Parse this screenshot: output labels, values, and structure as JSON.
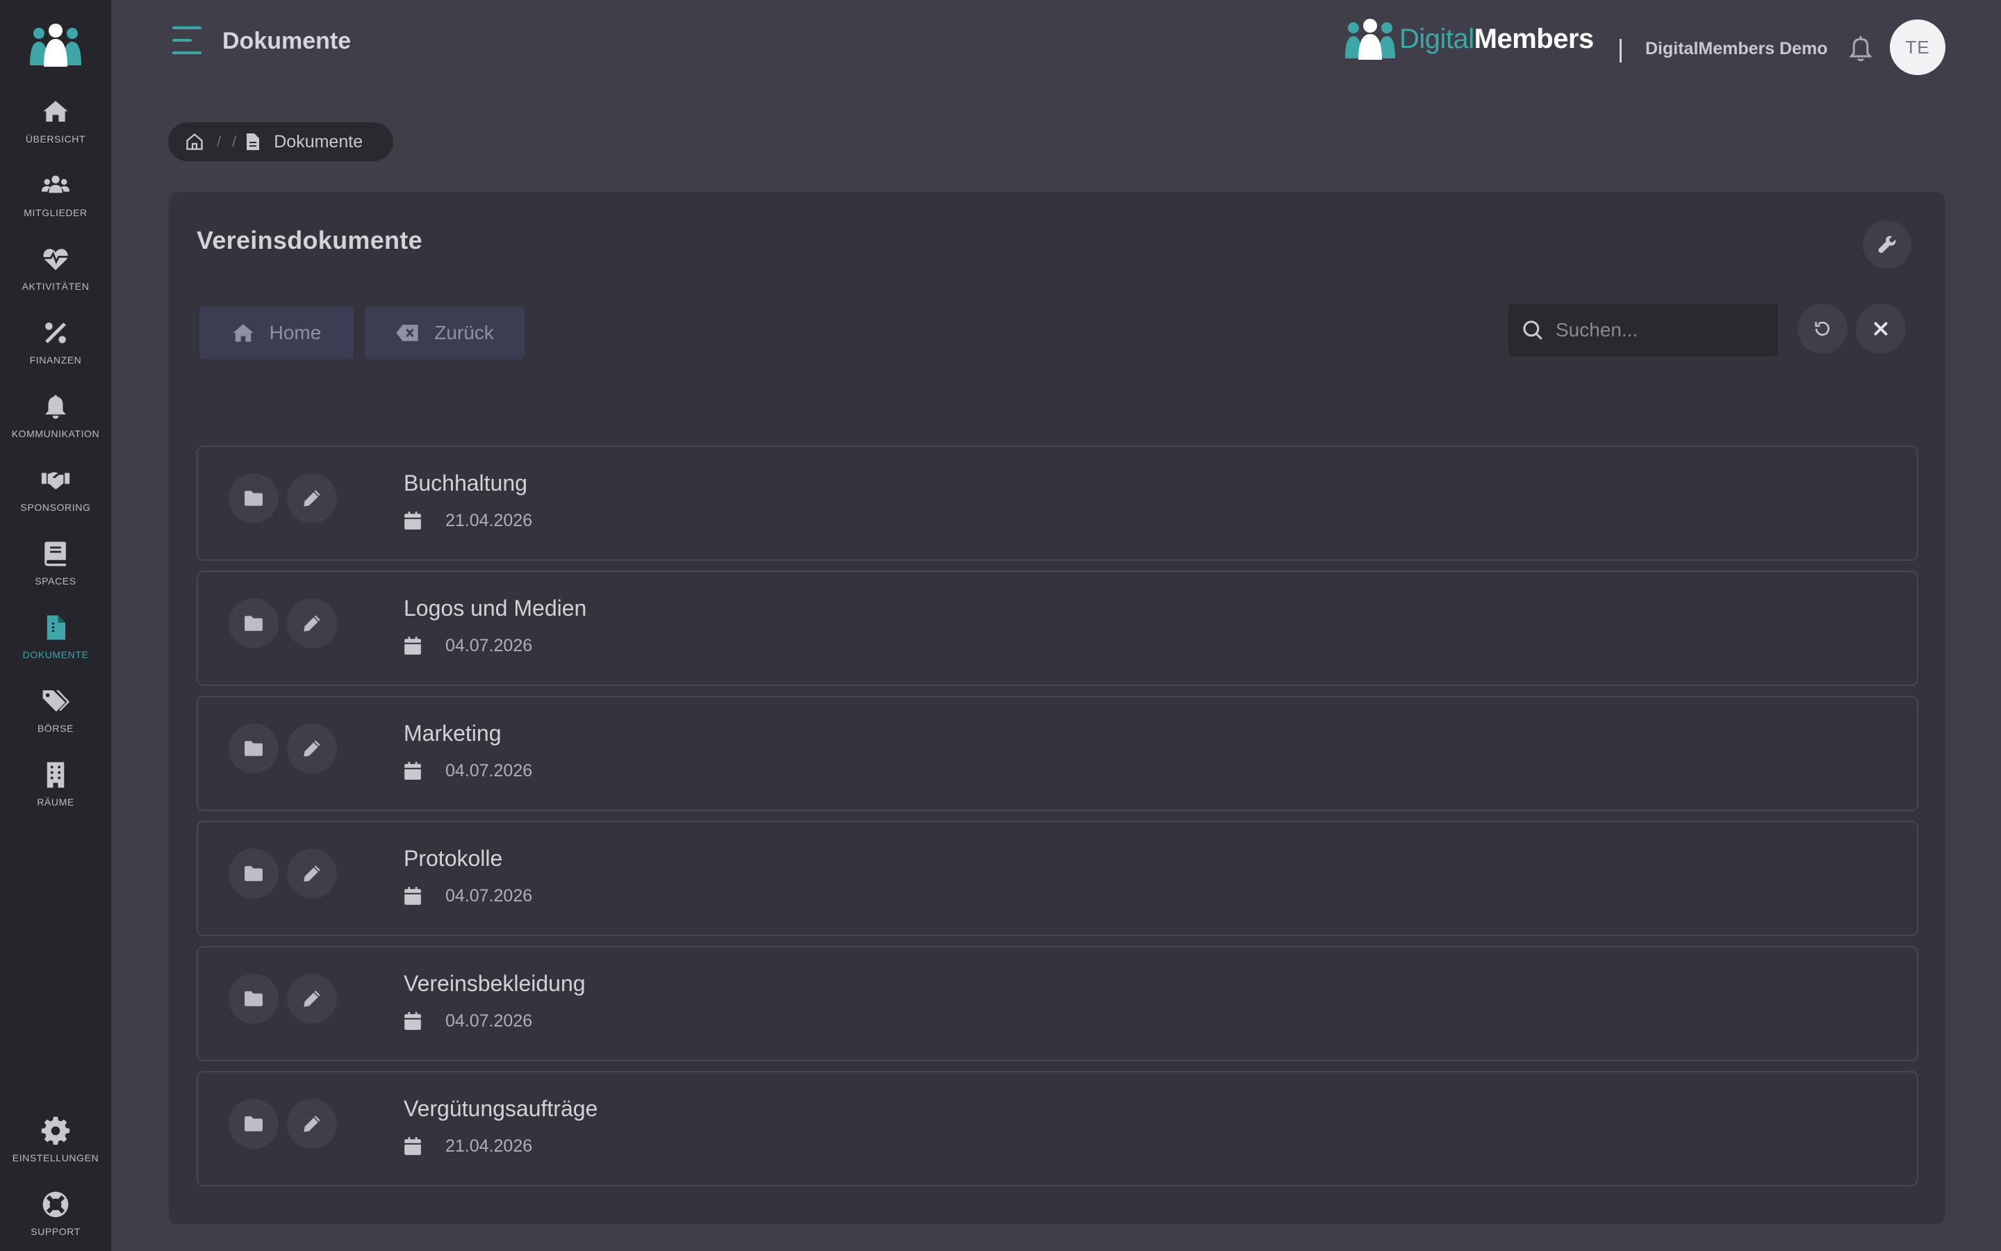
{
  "app": {
    "page_title": "Dokumente",
    "brand_part1": "Digital",
    "brand_part2": "Members",
    "org_name": "DigitalMembers Demo",
    "avatar_initials": "TE"
  },
  "colors": {
    "accent": "#3fa6a8",
    "sidebar_bg": "#26252b",
    "page_bg": "#403e48",
    "card_bg": "#35333c"
  },
  "sidebar": {
    "items": [
      {
        "label": "Übersicht",
        "icon": "home-icon"
      },
      {
        "label": "Mitglieder",
        "icon": "users-icon"
      },
      {
        "label": "Aktivitäten",
        "icon": "heartbeat-icon"
      },
      {
        "label": "Finanzen",
        "icon": "percent-icon"
      },
      {
        "label": "Kommunikation",
        "icon": "bell-icon"
      },
      {
        "label": "Sponsoring",
        "icon": "handshake-icon"
      },
      {
        "label": "Spaces",
        "icon": "book-icon"
      },
      {
        "label": "Dokumente",
        "icon": "document-icon",
        "active": true
      },
      {
        "label": "Börse",
        "icon": "tags-icon"
      },
      {
        "label": "Räume",
        "icon": "building-icon"
      }
    ],
    "bottom": [
      {
        "label": "Einstellungen",
        "icon": "gear-icon"
      },
      {
        "label": "Support",
        "icon": "lifebuoy-icon"
      }
    ]
  },
  "breadcrumb": {
    "current": "Dokumente",
    "separator": "/"
  },
  "card": {
    "title": "Vereinsdokumente",
    "home_button": "Home",
    "back_button": "Zurück",
    "search_placeholder": "Suchen..."
  },
  "documents": [
    {
      "name": "Buchhaltung",
      "date": "21.04.2026"
    },
    {
      "name": "Logos und Medien",
      "date": "04.07.2026"
    },
    {
      "name": "Marketing",
      "date": "04.07.2026"
    },
    {
      "name": "Protokolle",
      "date": "04.07.2026"
    },
    {
      "name": "Vereinsbekleidung",
      "date": "04.07.2026"
    },
    {
      "name": "Vergütungsaufträge",
      "date": "21.04.2026"
    }
  ]
}
